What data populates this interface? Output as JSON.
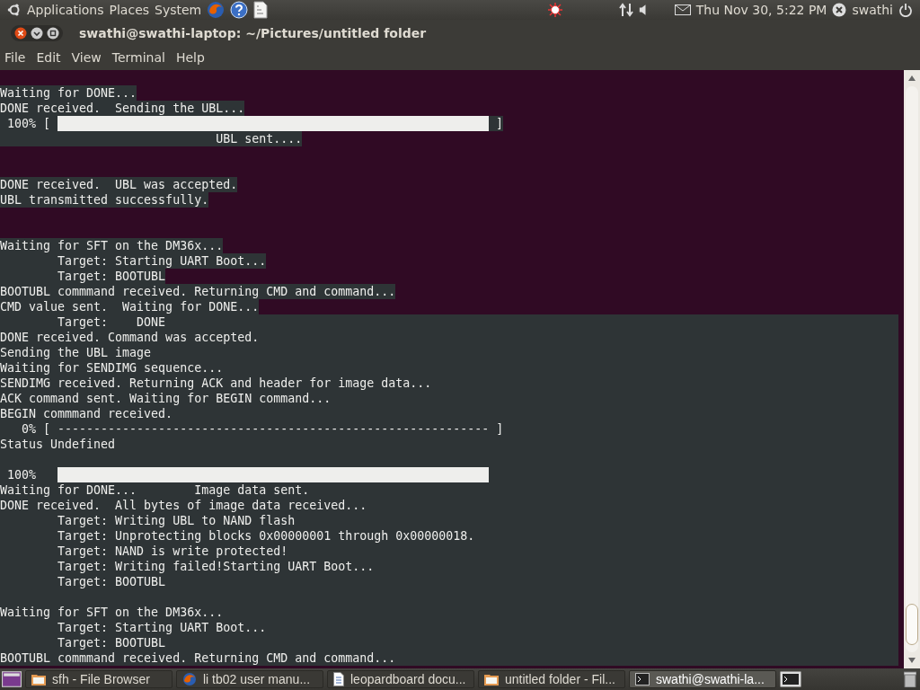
{
  "top_panel": {
    "menus": [
      "Applications",
      "Places",
      "System"
    ],
    "clock": "Thu Nov 30,  5:22 PM",
    "user": "swathi"
  },
  "window": {
    "title": "swathi@swathi-laptop: ~/Pictures/untitled folder"
  },
  "menu_bar": [
    "File",
    "Edit",
    "View",
    "Terminal",
    "Help"
  ],
  "terminal": {
    "lines": [
      {
        "kind": "text",
        "text": "Waiting for DONE..."
      },
      {
        "kind": "text",
        "text": "DONE received.  Sending the UBL..."
      },
      {
        "kind": "progress",
        "prefix": " 100% [ ",
        "level": 1,
        "suffix": " ]"
      },
      {
        "kind": "text",
        "text": "                              UBL sent...."
      },
      {
        "kind": "blank"
      },
      {
        "kind": "blank"
      },
      {
        "kind": "text",
        "text": "DONE received.  UBL was accepted."
      },
      {
        "kind": "text",
        "text": "UBL transmitted successfully."
      },
      {
        "kind": "blank"
      },
      {
        "kind": "blank"
      },
      {
        "kind": "text",
        "text": "Waiting for SFT on the DM36x..."
      },
      {
        "kind": "text",
        "text": "        Target: Starting UART Boot..."
      },
      {
        "kind": "text",
        "text": "        Target: BOOTUBL"
      },
      {
        "kind": "text",
        "text": "BOOTUBL commmand received. Returning CMD and command..."
      },
      {
        "kind": "text",
        "text": "CMD value sent.  Waiting for DONE..."
      }
    ],
    "block_lines": [
      {
        "kind": "text",
        "text": "        Target:    DONE"
      },
      {
        "kind": "text",
        "text": "DONE received. Command was accepted."
      },
      {
        "kind": "text",
        "text": "Sending the UBL image"
      },
      {
        "kind": "text",
        "text": "Waiting for SENDIMG sequence..."
      },
      {
        "kind": "text",
        "text": "SENDIMG received. Returning ACK and header for image data..."
      },
      {
        "kind": "text",
        "text": "ACK command sent. Waiting for BEGIN command..."
      },
      {
        "kind": "text",
        "text": "BEGIN commmand received."
      },
      {
        "kind": "text",
        "text": "   0% [ ------------------------------------------------------------ ]"
      },
      {
        "kind": "text",
        "text": "Status Undefined"
      },
      {
        "kind": "blank"
      },
      {
        "kind": "progress",
        "prefix": " 100%   ",
        "level": 1
      },
      {
        "kind": "text",
        "text": "Waiting for DONE...        Image data sent."
      },
      {
        "kind": "text",
        "text": "DONE received.  All bytes of image data received..."
      },
      {
        "kind": "text",
        "text": "        Target: Writing UBL to NAND flash"
      },
      {
        "kind": "text",
        "text": "        Target: Unprotecting blocks 0x00000001 through 0x00000018."
      },
      {
        "kind": "text",
        "text": "        Target: NAND is write protected!"
      },
      {
        "kind": "text",
        "text": "        Target: Writing failed!Starting UART Boot..."
      },
      {
        "kind": "text",
        "text": "        Target: BOOTUBL"
      },
      {
        "kind": "blank"
      },
      {
        "kind": "text",
        "text": "Waiting for SFT on the DM36x..."
      },
      {
        "kind": "text",
        "text": "        Target: Starting UART Boot..."
      },
      {
        "kind": "text",
        "text": "        Target: BOOTUBL"
      },
      {
        "kind": "text",
        "text": "BOOTUBL commmand received. Returning CMD and command..."
      }
    ]
  },
  "taskbar": {
    "tasks": [
      {
        "label": "sfh - File Browser",
        "kind": "folder",
        "selected": false
      },
      {
        "label": "li tb02 user manu...",
        "kind": "browser",
        "selected": false
      },
      {
        "label": "leopardboard docu...",
        "kind": "document",
        "selected": false
      },
      {
        "label": "untitled folder - Fil...",
        "kind": "folder",
        "selected": false
      },
      {
        "label": "swathi@swathi-la...",
        "kind": "terminal",
        "selected": true
      }
    ]
  }
}
